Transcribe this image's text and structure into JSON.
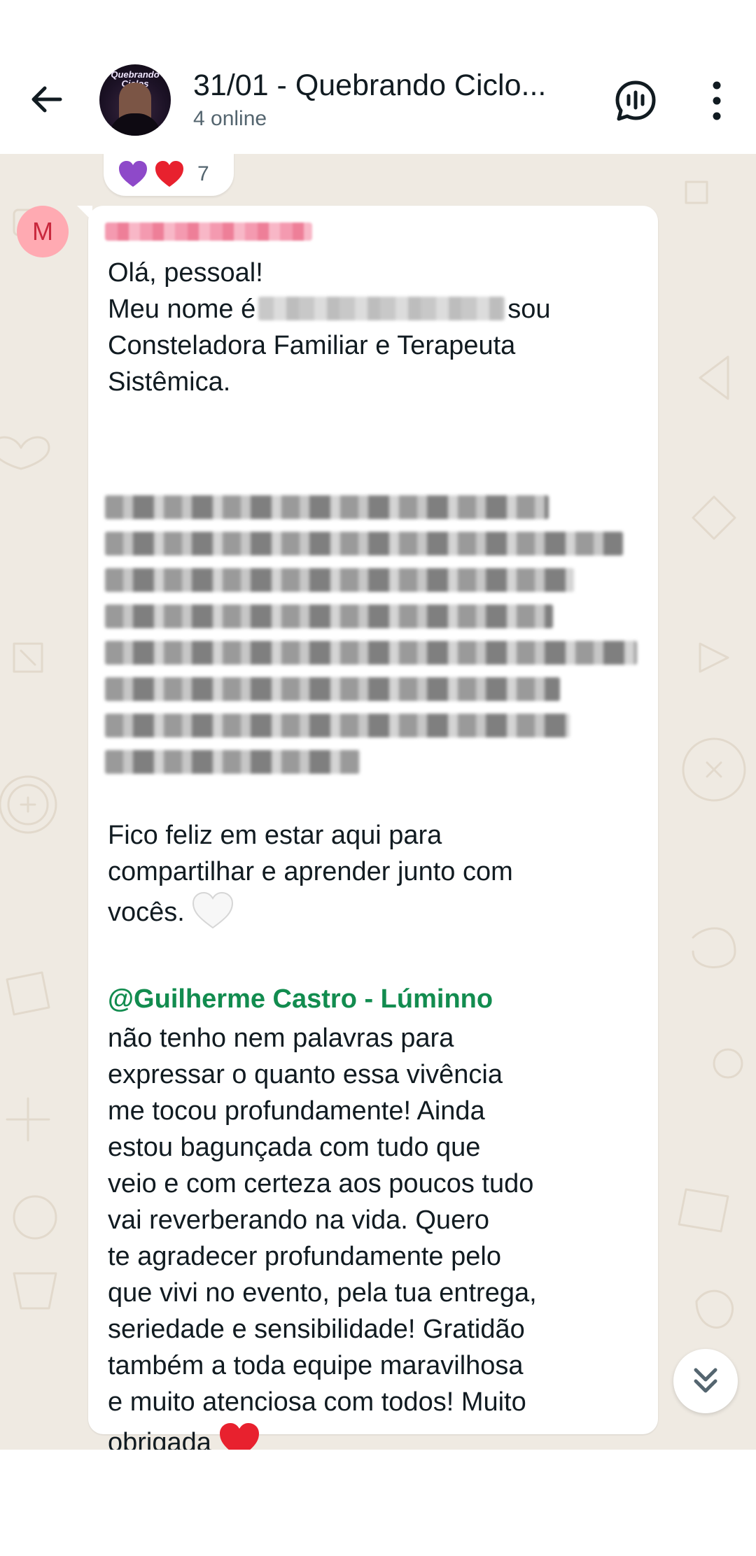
{
  "header": {
    "title": "31/01 - Quebrando Ciclo...",
    "subtitle": "4 online",
    "avatar_brand": "Quebrando Ciclos"
  },
  "reactions": {
    "emojis": [
      "purple-heart",
      "red-heart"
    ],
    "count": "7"
  },
  "message": {
    "sender_initial": "M",
    "sender_name": "redacted",
    "greeting": "Olá, pessoal!",
    "intro_prefix": "Meu nome é",
    "intro_name": "redacted",
    "intro_suffix": "sou",
    "intro_line2": "Consteladora Familiar e Terapeuta",
    "intro_line3": "Sistêmica.",
    "closing_line1": "Fico feliz em estar aqui para",
    "closing_line2": "compartilhar e aprender junto com",
    "closing_line3": "vocês.",
    "mention": "@Guilherme Castro - Lúminno",
    "body_lines": [
      "não tenho nem palavras para",
      "expressar o quanto essa vivência",
      "me tocou profundamente! Ainda",
      "estou bagunçada com tudo que",
      "veio e com certeza aos poucos tudo",
      "vai reverberando na vida. Quero",
      "te agradecer profundamente pelo",
      "que vivi no evento, pela tua entrega,",
      "seriedade e sensibilidade! Gratidão",
      "também a toda equipe maravilhosa",
      "e muito atenciosa com todos! Muito"
    ],
    "last_line": "obrigada"
  },
  "colors": {
    "mention": "#128c4f",
    "chat_bg": "#efeae2",
    "avatar_bg": "#ffaab2",
    "heart": "#e8212e"
  }
}
